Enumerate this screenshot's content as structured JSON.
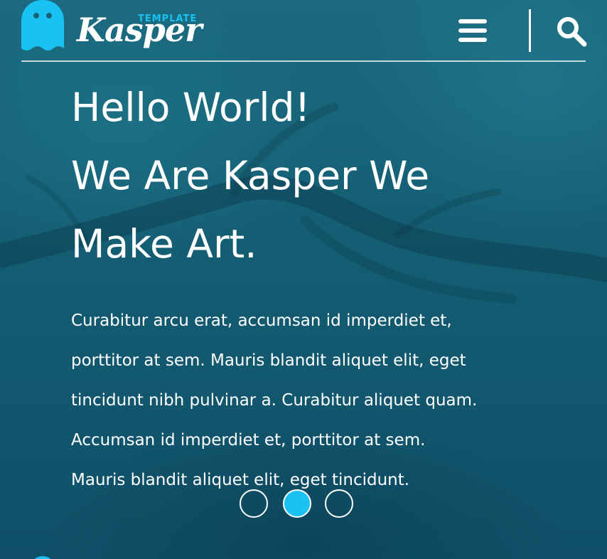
{
  "colors": {
    "background": "#176379",
    "accent": "#19c2f2",
    "text": "#ffffff"
  },
  "header": {
    "logo": {
      "icon": "ghost-icon",
      "template_label": "TEMPLATE",
      "name": "Kasper"
    },
    "menu_icon": "hamburger-menu-icon",
    "search_icon": "search-icon"
  },
  "hero": {
    "headline_lines": [
      "Hello World!",
      "We Are Kasper We",
      "Make Art."
    ],
    "paragraph_lines": [
      "Curabitur arcu erat, accumsan id imperdiet et,",
      "porttitor at sem. Mauris blandit aliquet elit, eget",
      "tincidunt nibh pulvinar a. Curabitur aliquet quam.",
      "Accumsan id imperdiet et, porttitor at sem.",
      "Mauris blandit aliquet elit, eget tincidunt."
    ],
    "slider": {
      "total": 3,
      "active_index": 1
    }
  }
}
